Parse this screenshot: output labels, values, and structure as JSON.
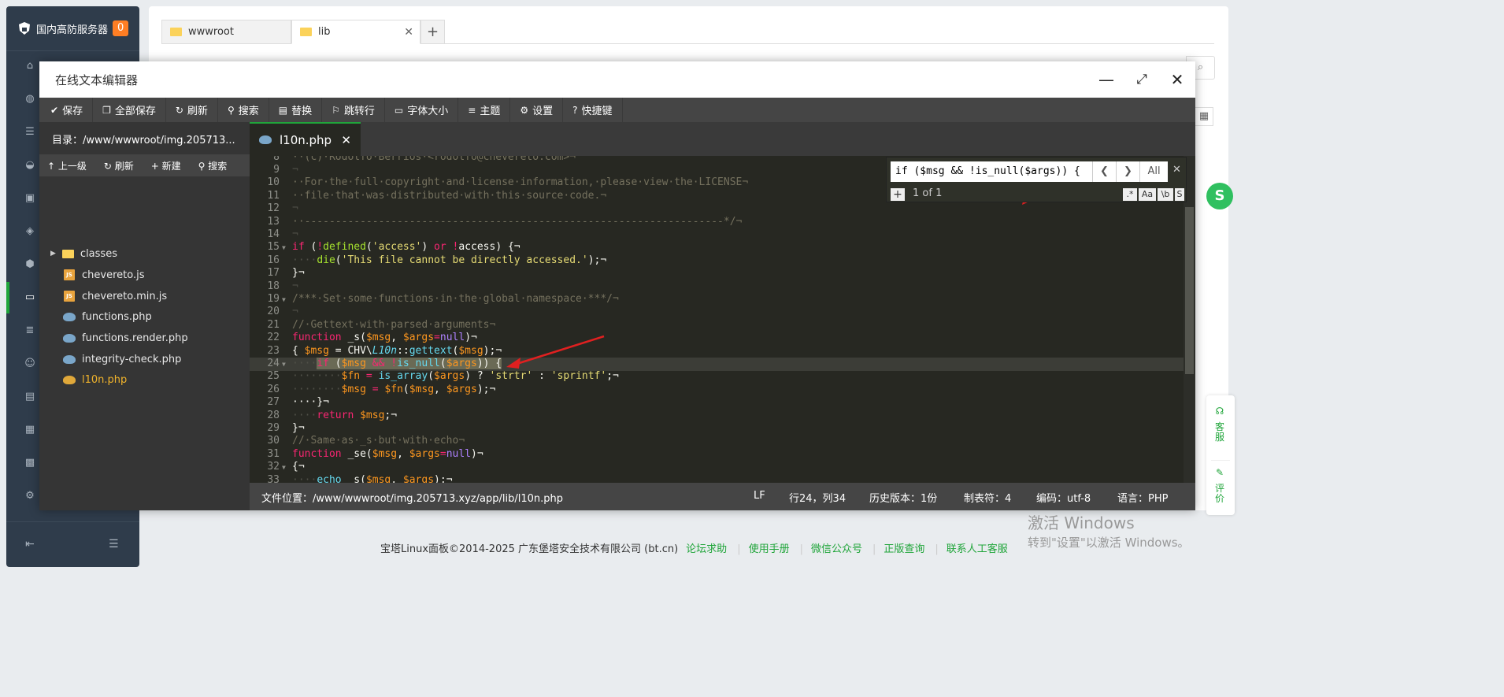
{
  "sidebar": {
    "brand": "国内高防服务器",
    "badge": "0",
    "home_partial": "首页"
  },
  "top_tabs": [
    {
      "label": "wwwroot"
    },
    {
      "label": "lib"
    }
  ],
  "page_partial": {
    "right_edge_text": "页"
  },
  "modal": {
    "title": "在线文本编辑器",
    "toolbar": {
      "save": "保存",
      "save_all": "全部保存",
      "refresh": "刷新",
      "search": "搜索",
      "replace": "替换",
      "goto_line": "跳转行",
      "font_size": "字体大小",
      "theme": "主题",
      "settings": "设置",
      "shortcuts": "快捷键"
    }
  },
  "file_panel": {
    "dir_label": "目录：/www/wwwroot/img.205713...",
    "actions": {
      "up": "上一级",
      "refresh": "刷新",
      "new": "新建",
      "search": "搜索"
    },
    "files": [
      {
        "name": "classes",
        "type": "folder"
      },
      {
        "name": "chevereto.js",
        "type": "js"
      },
      {
        "name": "chevereto.min.js",
        "type": "js"
      },
      {
        "name": "functions.php",
        "type": "php"
      },
      {
        "name": "functions.render.php",
        "type": "php"
      },
      {
        "name": "integrity-check.php",
        "type": "php"
      },
      {
        "name": "l10n.php",
        "type": "php",
        "active": true
      }
    ]
  },
  "editor": {
    "tab_name": "l10n.php",
    "search": {
      "query": "if ($msg && !is_null($args)) {",
      "count": "1 of 1",
      "all_label": "All",
      "options": [
        ".*",
        "Aa",
        "\\b",
        "S"
      ]
    },
    "line_numbers": [
      "8",
      "9",
      "10",
      "11",
      "12",
      "13",
      "14",
      "15",
      "16",
      "17",
      "18",
      "19",
      "20",
      "21",
      "22",
      "23",
      "24",
      "25",
      "26",
      "27",
      "28",
      "29",
      "30",
      "31",
      "32",
      "33"
    ],
    "code": {
      "l8": "··(c)·Rodolfo·Berrios·<rodolfo@chevereto.com>¬",
      "l9": "¬",
      "l10": "··For·the·full·copyright·and·license·information,·please·view·the·LICENSE¬",
      "l11": "··file·that·was·distributed·with·this·source·code.¬",
      "l12": "¬",
      "l13": "··--------------------------------------------------------------------*/¬",
      "l14": "¬",
      "l15_kw": "if",
      "l15_a": " (",
      "l15_not": "!",
      "l15_fn": "defined",
      "l15_b": "(",
      "l15_str": "'access'",
      "l15_c": ") ",
      "l15_or": "or",
      "l15_d": " ",
      "l15_not2": "!",
      "l15_e": "access) {¬",
      "l16_ws": "····",
      "l16_fn": "die",
      "l16_a": "(",
      "l16_str": "'This file cannot be directly accessed.'",
      "l16_b": ");¬",
      "l17": "}¬",
      "l18": "¬",
      "l19": "/***·Set·some·functions·in·the·global·namespace·***/¬",
      "l20": "¬",
      "l21": "//·Gettext·with·parsed·arguments¬",
      "l22_kw": "function",
      "l22_a": " _s(",
      "l22_v1": "$msg",
      "l22_b": ", ",
      "l22_v2": "$args",
      "l22_c": "=",
      "l22_null": "null",
      "l22_d": ")¬",
      "l23_a": "{ ",
      "l23_v1": "$msg",
      "l23_b": " = CHV\\",
      "l23_cls": "L10n",
      "l23_c": "::",
      "l23_fn": "gettext",
      "l23_d": "(",
      "l23_v2": "$msg",
      "l23_e": ");¬",
      "l24_ws": "····",
      "l24_kw": "if",
      "l24_a": " (",
      "l24_v1": "$msg",
      "l24_b": " ",
      "l24_and": "&&",
      "l24_c": " !",
      "l24_fn": "is_null",
      "l24_d": "(",
      "l24_v2": "$args",
      "l24_e": ")) {",
      "l25_ws": "········",
      "l25_v1": "$fn",
      "l25_a": " = ",
      "l25_fn": "is_array",
      "l25_b": "(",
      "l25_v2": "$args",
      "l25_c": ") ? ",
      "l25_s1": "'strtr'",
      "l25_d": " : ",
      "l25_s2": "'sprintf'",
      "l25_e": ";¬",
      "l26_ws": "········",
      "l26_v1": "$msg",
      "l26_a": " = ",
      "l26_v2": "$fn",
      "l26_b": "(",
      "l26_v3": "$msg",
      "l26_c": ", ",
      "l26_v4": "$args",
      "l26_d": ");¬",
      "l27": "····}¬",
      "l28_ws": "····",
      "l28_kw": "return",
      "l28_a": " ",
      "l28_v": "$msg",
      "l28_b": ";¬",
      "l29": "}¬",
      "l30": "//·Same·as·_s·but·with·echo¬",
      "l31_kw": "function",
      "l31_a": " _se(",
      "l31_v1": "$msg",
      "l31_b": ", ",
      "l31_v2": "$args",
      "l31_c": "=",
      "l31_null": "null",
      "l31_d": ")¬",
      "l32": "{¬",
      "l33_ws": "····",
      "l33_fn": "echo",
      "l33_a": " _s(",
      "l33_v1": "$msg",
      "l33_b": ", ",
      "l33_v2": "$args",
      "l33_c": ");¬"
    }
  },
  "status_bar": {
    "file_path": "文件位置：/www/wwwroot/img.205713.xyz/app/lib/l10n.php",
    "eol": "LF",
    "cursor": "行24，列34",
    "history": "历史版本：1份",
    "tab_size": "制表符：4",
    "encoding": "编码：utf-8",
    "language": "语言：PHP"
  },
  "footer": {
    "copyright": "宝塔Linux面板©2014-2025 广东堡塔安全技术有限公司 (bt.cn)",
    "links": [
      "论坛求助",
      "使用手册",
      "微信公众号",
      "正版查询",
      "联系人工客服"
    ]
  },
  "watermark": {
    "line1": "激活 Windows",
    "line2": "转到\"设置\"以激活 Windows。"
  },
  "right_widget": {
    "service": "客服",
    "feedback": "评价"
  },
  "colors": {
    "accent": "#20a53a",
    "sidebar_bg": "#2f3c4b",
    "editor_bg": "#272822",
    "toolbar_bg": "#454545",
    "badge": "#ff7e24",
    "active_file": "#f0b32b"
  }
}
